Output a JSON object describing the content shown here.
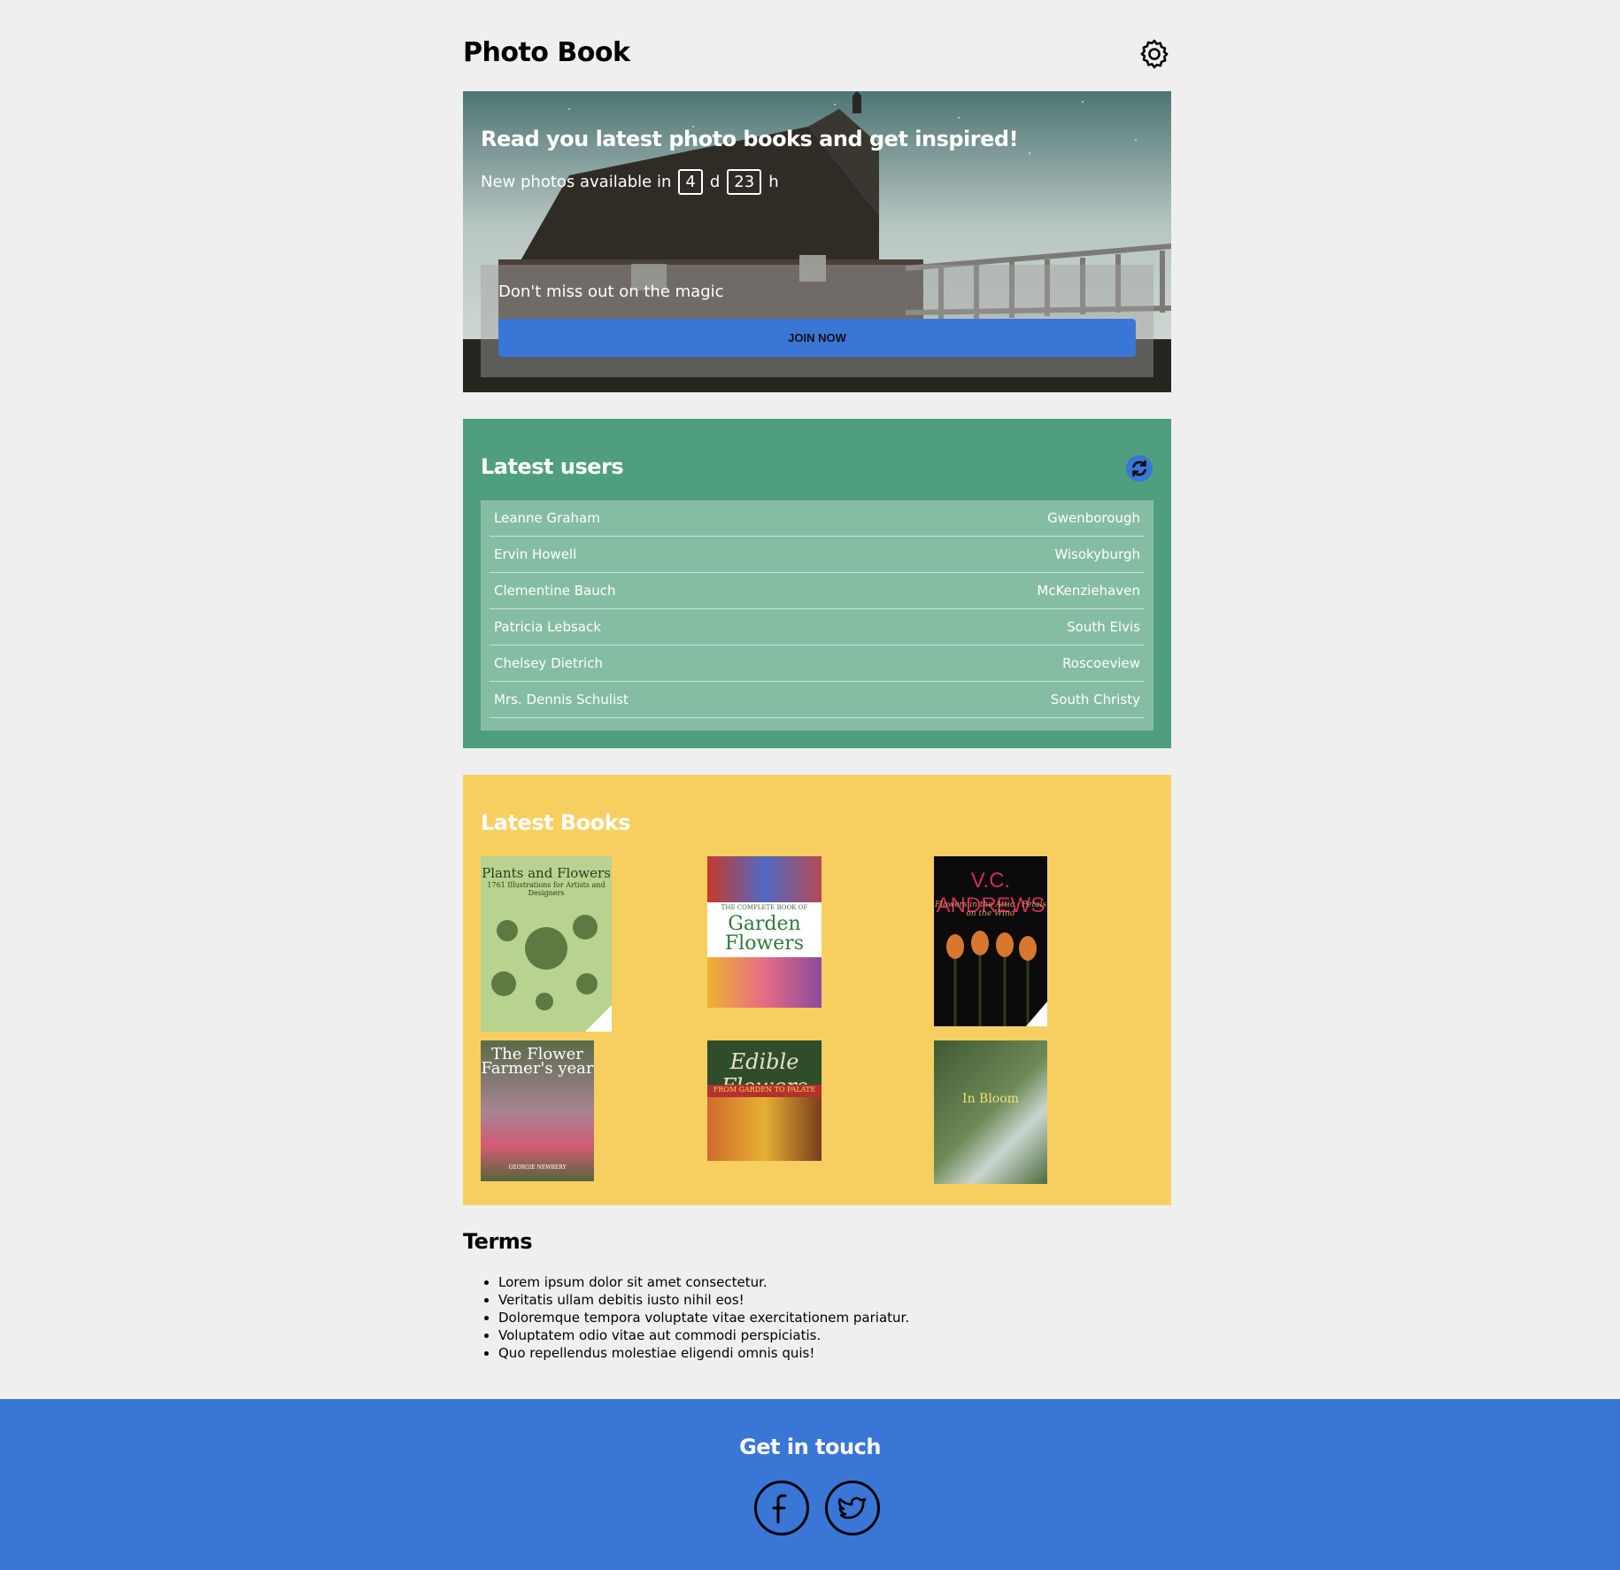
{
  "header": {
    "title": "Photo Book",
    "settings_icon": "gear-icon"
  },
  "hero": {
    "heading": "Read you latest photo books and get inspired!",
    "available_label": "New photos available in",
    "days_value": "4",
    "days_unit": "d",
    "hours_value": "23",
    "hours_unit": "h",
    "magic_text": "Don't miss out on the magic",
    "join_label": "JOIN NOW"
  },
  "users": {
    "title": "Latest users",
    "refresh_icon": "refresh-icon",
    "items": [
      {
        "name": "Leanne Graham",
        "city": "Gwenborough"
      },
      {
        "name": "Ervin Howell",
        "city": "Wisokyburgh"
      },
      {
        "name": "Clementine Bauch",
        "city": "McKenziehaven"
      },
      {
        "name": "Patricia Lebsack",
        "city": "South Elvis"
      },
      {
        "name": "Chelsey Dietrich",
        "city": "Roscoeview"
      },
      {
        "name": "Mrs. Dennis Schulist",
        "city": "South Christy"
      }
    ]
  },
  "books": {
    "title": "Latest Books",
    "covers": [
      {
        "title": "Plants and Flowers",
        "subtitle": "1761 Illustrations for Artists and Designers"
      },
      {
        "title": "Garden Flowers",
        "subtitle": "THE COMPLETE BOOK OF"
      },
      {
        "title": "V.C. ANDREWS",
        "subtitle": "Flowers in the Attic · Petals on the Wind"
      },
      {
        "title": "The Flower Farmer's year",
        "subtitle": "GEORGIE NEWBERY"
      },
      {
        "title": "Edible Flowers",
        "subtitle": "FROM GARDEN TO PALATE"
      },
      {
        "title": "In Bloom",
        "subtitle": ""
      }
    ]
  },
  "terms": {
    "title": "Terms",
    "items": [
      "Lorem ipsum dolor sit amet consectetur.",
      "Veritatis ullam debitis iusto nihil eos!",
      "Doloremque tempora voluptate vitae exercitationem pariatur.",
      "Voluptatem odio vitae aut commodi perspiciatis.",
      "Quo repellendus molestiae eligendi omnis quis!"
    ]
  },
  "footer": {
    "title": "Get in touch",
    "facebook_icon": "facebook-icon",
    "twitter_icon": "twitter-icon"
  },
  "colors": {
    "accent": "#3a76d6",
    "users_bg": "#4f9f7e",
    "books_bg": "#f7cf61",
    "page_bg": "#efefef"
  }
}
